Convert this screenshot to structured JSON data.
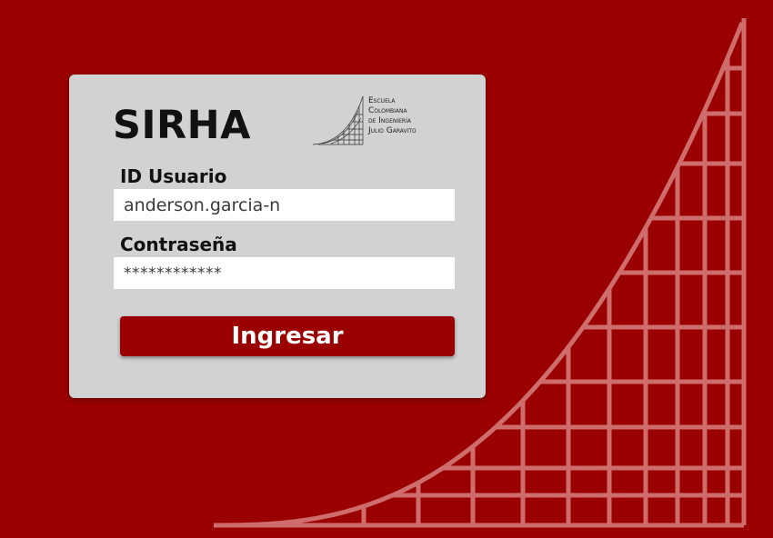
{
  "app": {
    "title": "SIRHA"
  },
  "logo": {
    "icon": "escuela-colombiana-logo-icon",
    "lines": [
      "Escuela",
      "Colombiana",
      "de Ingeniería",
      "Julio Garavito"
    ]
  },
  "form": {
    "user_label": "ID Usuario",
    "user_value": "anderson.garcia-n",
    "password_label": "Contraseña",
    "password_value": "************",
    "submit_label": "Ingresar"
  },
  "colors": {
    "background": "#9a0000",
    "card": "#d2d2d2",
    "button": "#9a0000",
    "button_text": "#ffffff",
    "art_lines": "#d98080"
  }
}
